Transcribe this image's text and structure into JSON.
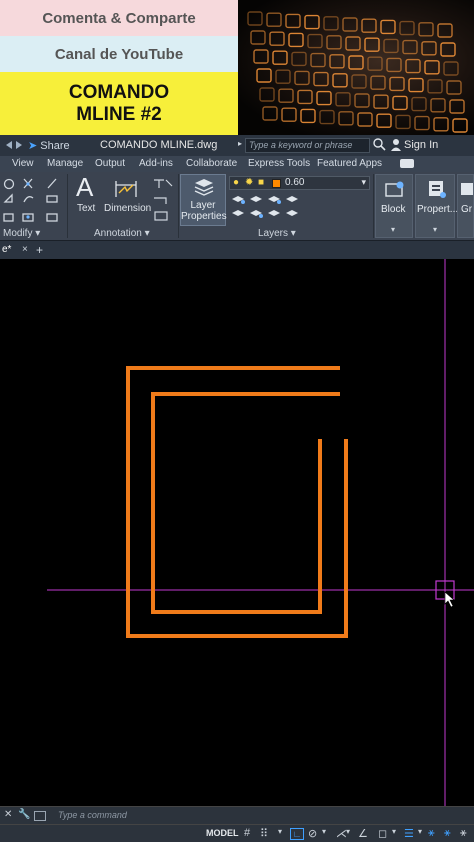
{
  "banner": {
    "line1": "Comenta & Comparte",
    "line2": "Canal de YouTube",
    "title_line1": "COMANDO",
    "title_line2": "MLINE #2"
  },
  "titlebar": {
    "share": "Share",
    "document": "COMANDO MLINE.dwg",
    "search_placeholder": "Type a keyword or phrase",
    "sign_in": "Sign In"
  },
  "tabs": [
    "View",
    "Manage",
    "Output",
    "Add-ins",
    "Collaborate",
    "Express Tools",
    "Featured Apps"
  ],
  "ribbon": {
    "modify_label": "Modify",
    "text_label": "Text",
    "dimension_label": "Dimension",
    "annotation_label": "Annotation",
    "layer_properties_label": "Layer Properties",
    "layer_current_value": "0.60",
    "layers_label": "Layers",
    "block_label": "Block",
    "properties_label": "Propert...",
    "groups_label": "Gr"
  },
  "command": {
    "placeholder": "Type a command"
  },
  "statusbar": {
    "model": "MODEL"
  },
  "colors": {
    "mline": "#f07b1a",
    "crosshair": "#c23ad0",
    "canvas": "#000000"
  }
}
